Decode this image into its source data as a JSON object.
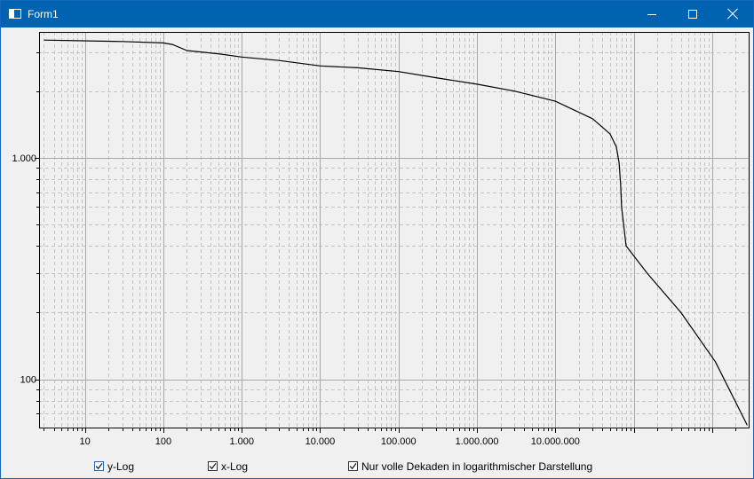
{
  "window": {
    "title": "Form1",
    "icon": "window-form-icon"
  },
  "chart_data": {
    "type": "line",
    "x_scale": "log",
    "y_scale": "log",
    "xlim": [
      2.6,
      3000000000
    ],
    "ylim": [
      60,
      3700
    ],
    "x_tick_values": [
      10,
      100,
      1000,
      10000,
      100000,
      1000000,
      10000000
    ],
    "x_tick_labels": [
      "10",
      "100",
      "1.000",
      "10.000",
      "100.000",
      "1.000.000",
      "10.000.000"
    ],
    "y_tick_values": [
      100,
      1000
    ],
    "y_tick_labels": [
      "100",
      "1.000"
    ],
    "grid": "major solid, minor dashed",
    "series": [
      {
        "color": "#000000",
        "x": [
          3,
          30,
          100,
          130,
          200,
          500,
          1000,
          3000,
          10000,
          30000,
          100000,
          300000,
          1000000,
          3000000,
          10000000,
          30000000,
          50000000,
          60000000,
          65000000,
          68000000,
          70000000,
          80000000,
          150000000,
          400000000,
          1100000000,
          2800000000
        ],
        "y": [
          3400,
          3350,
          3300,
          3250,
          3050,
          2950,
          2850,
          2750,
          2600,
          2550,
          2450,
          2300,
          2150,
          2000,
          1800,
          1500,
          1280,
          1120,
          950,
          760,
          600,
          400,
          300,
          200,
          120,
          62
        ]
      }
    ]
  },
  "checkboxes": {
    "ylog": {
      "label": "y-Log",
      "checked": true
    },
    "xlog": {
      "label": "x-Log",
      "checked": true
    },
    "decades": {
      "label": "Nur volle Dekaden in logarithmischer Darstellung",
      "checked": true
    }
  }
}
